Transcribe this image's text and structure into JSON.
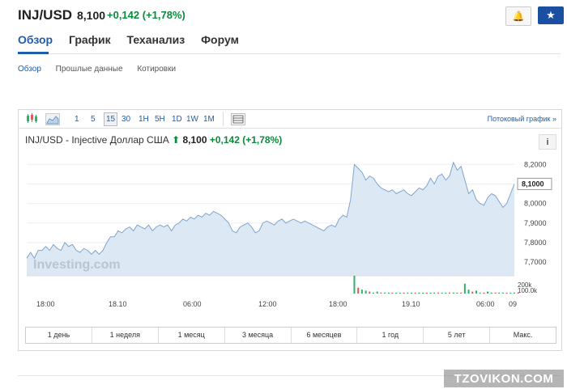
{
  "header": {
    "symbol": "INJ/USD",
    "price": "8,100",
    "change": "+0,142",
    "change_pct": "(+1,78%)"
  },
  "tabs": [
    "Обзор",
    "График",
    "Теханализ",
    "Форум"
  ],
  "subtabs": [
    "Обзор",
    "Прошлые данные",
    "Котировки"
  ],
  "toolbar": {
    "intervals": [
      "1",
      "5",
      "15",
      "30",
      "1H",
      "5H",
      "1D",
      "1W",
      "1M"
    ],
    "active_interval": "15",
    "stream_label": "Потоковый график",
    "stream_arrow": "»"
  },
  "chart_header": {
    "name": "INJ/USD - Injective Доллар США",
    "price": "8,100",
    "change": "+0,142",
    "change_pct": "(+1,78%)",
    "info": "i"
  },
  "chart_data": {
    "type": "area",
    "x_ticks": [
      "18:00",
      "18.10",
      "06:00",
      "12:00",
      "18:00",
      "19.10",
      "06:00",
      "09"
    ],
    "y_ticks": [
      "8,2000",
      "8,1000",
      "8,0000",
      "7,9000",
      "7,8000",
      "7,7000"
    ],
    "ylim": [
      7.63,
      8.23
    ],
    "last_value_label": "8,1000",
    "volume_label": "200k",
    "volume_label2": "100.0k",
    "watermark": "Investing.com",
    "values": [
      7.72,
      7.75,
      7.72,
      7.76,
      7.76,
      7.78,
      7.76,
      7.79,
      7.77,
      7.76,
      7.8,
      7.78,
      7.79,
      7.76,
      7.75,
      7.77,
      7.76,
      7.74,
      7.76,
      7.74,
      7.76,
      7.8,
      7.83,
      7.83,
      7.86,
      7.85,
      7.87,
      7.88,
      7.86,
      7.89,
      7.88,
      7.87,
      7.89,
      7.86,
      7.88,
      7.89,
      7.88,
      7.89,
      7.86,
      7.89,
      7.9,
      7.92,
      7.91,
      7.93,
      7.92,
      7.94,
      7.93,
      7.95,
      7.94,
      7.96,
      7.95,
      7.94,
      7.92,
      7.9,
      7.86,
      7.85,
      7.88,
      7.89,
      7.9,
      7.88,
      7.85,
      7.86,
      7.9,
      7.91,
      7.9,
      7.89,
      7.91,
      7.92,
      7.9,
      7.91,
      7.92,
      7.91,
      7.9,
      7.91,
      7.9,
      7.89,
      7.88,
      7.87,
      7.86,
      7.88,
      7.89,
      7.88,
      7.92,
      7.94,
      7.93,
      8.02,
      8.2,
      8.18,
      8.16,
      8.12,
      8.14,
      8.13,
      8.1,
      8.08,
      8.07,
      8.06,
      8.07,
      8.05,
      8.06,
      8.07,
      8.05,
      8.04,
      8.06,
      8.08,
      8.07,
      8.09,
      8.13,
      8.1,
      8.14,
      8.15,
      8.12,
      8.14,
      8.21,
      8.17,
      8.19,
      8.12,
      8.05,
      8.07,
      8.02,
      8.0,
      7.99,
      8.03,
      8.05,
      8.04,
      8.01,
      7.98,
      8.0,
      8.05,
      8.1
    ],
    "volumes": [
      0,
      0,
      0,
      0,
      0,
      0,
      0,
      0,
      0,
      0,
      0,
      0,
      0,
      0,
      0,
      0,
      0,
      0,
      0,
      0,
      0,
      0,
      0,
      0,
      0,
      0,
      0,
      0,
      0,
      0,
      0,
      0,
      0,
      0,
      0,
      0,
      0,
      0,
      0,
      0,
      0,
      0,
      0,
      0,
      0,
      0,
      0,
      0,
      0,
      0,
      0,
      0,
      0,
      0,
      0,
      0,
      0,
      0,
      0,
      0,
      0,
      0,
      0,
      0,
      0,
      0,
      0,
      0,
      0,
      0,
      0,
      0,
      0,
      0,
      0,
      0,
      0,
      0,
      0,
      0,
      0,
      0,
      0,
      0,
      0,
      0,
      18,
      6,
      4,
      3,
      2,
      1,
      2,
      1,
      1,
      1,
      1,
      1,
      1,
      1,
      1,
      1,
      1,
      1,
      1,
      1,
      1,
      1,
      1,
      1,
      1,
      1,
      1,
      1,
      1,
      10,
      4,
      2,
      3,
      1,
      1,
      2,
      1,
      1,
      1,
      1,
      1,
      1,
      1,
      1
    ]
  },
  "ranges": [
    "1 день",
    "1 неделя",
    "1 месяц",
    "3 месяца",
    "6 месяцев",
    "1 год",
    "5 лет",
    "Макс."
  ],
  "watermark_site": "TZOVIKON.COM",
  "colors": {
    "accent": "#1f5dab",
    "up": "#0a8a3a",
    "area": "#dce8f3",
    "line": "#7fa6cc",
    "vol_up": "#2db36a",
    "vol_down": "#e05b5b"
  }
}
